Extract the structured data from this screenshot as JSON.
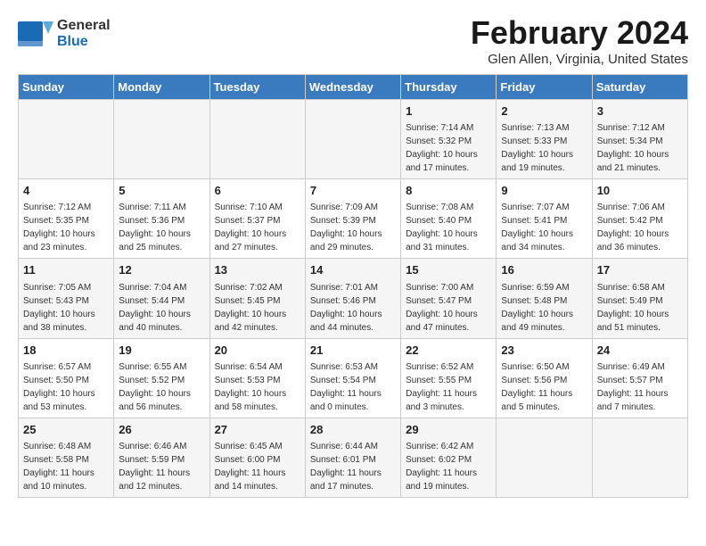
{
  "header": {
    "logo_line1": "General",
    "logo_line2": "Blue",
    "title": "February 2024",
    "subtitle": "Glen Allen, Virginia, United States"
  },
  "calendar": {
    "days_of_week": [
      "Sunday",
      "Monday",
      "Tuesday",
      "Wednesday",
      "Thursday",
      "Friday",
      "Saturday"
    ],
    "weeks": [
      [
        {
          "day": "",
          "info": ""
        },
        {
          "day": "",
          "info": ""
        },
        {
          "day": "",
          "info": ""
        },
        {
          "day": "",
          "info": ""
        },
        {
          "day": "1",
          "info": "Sunrise: 7:14 AM\nSunset: 5:32 PM\nDaylight: 10 hours\nand 17 minutes."
        },
        {
          "day": "2",
          "info": "Sunrise: 7:13 AM\nSunset: 5:33 PM\nDaylight: 10 hours\nand 19 minutes."
        },
        {
          "day": "3",
          "info": "Sunrise: 7:12 AM\nSunset: 5:34 PM\nDaylight: 10 hours\nand 21 minutes."
        }
      ],
      [
        {
          "day": "4",
          "info": "Sunrise: 7:12 AM\nSunset: 5:35 PM\nDaylight: 10 hours\nand 23 minutes."
        },
        {
          "day": "5",
          "info": "Sunrise: 7:11 AM\nSunset: 5:36 PM\nDaylight: 10 hours\nand 25 minutes."
        },
        {
          "day": "6",
          "info": "Sunrise: 7:10 AM\nSunset: 5:37 PM\nDaylight: 10 hours\nand 27 minutes."
        },
        {
          "day": "7",
          "info": "Sunrise: 7:09 AM\nSunset: 5:39 PM\nDaylight: 10 hours\nand 29 minutes."
        },
        {
          "day": "8",
          "info": "Sunrise: 7:08 AM\nSunset: 5:40 PM\nDaylight: 10 hours\nand 31 minutes."
        },
        {
          "day": "9",
          "info": "Sunrise: 7:07 AM\nSunset: 5:41 PM\nDaylight: 10 hours\nand 34 minutes."
        },
        {
          "day": "10",
          "info": "Sunrise: 7:06 AM\nSunset: 5:42 PM\nDaylight: 10 hours\nand 36 minutes."
        }
      ],
      [
        {
          "day": "11",
          "info": "Sunrise: 7:05 AM\nSunset: 5:43 PM\nDaylight: 10 hours\nand 38 minutes."
        },
        {
          "day": "12",
          "info": "Sunrise: 7:04 AM\nSunset: 5:44 PM\nDaylight: 10 hours\nand 40 minutes."
        },
        {
          "day": "13",
          "info": "Sunrise: 7:02 AM\nSunset: 5:45 PM\nDaylight: 10 hours\nand 42 minutes."
        },
        {
          "day": "14",
          "info": "Sunrise: 7:01 AM\nSunset: 5:46 PM\nDaylight: 10 hours\nand 44 minutes."
        },
        {
          "day": "15",
          "info": "Sunrise: 7:00 AM\nSunset: 5:47 PM\nDaylight: 10 hours\nand 47 minutes."
        },
        {
          "day": "16",
          "info": "Sunrise: 6:59 AM\nSunset: 5:48 PM\nDaylight: 10 hours\nand 49 minutes."
        },
        {
          "day": "17",
          "info": "Sunrise: 6:58 AM\nSunset: 5:49 PM\nDaylight: 10 hours\nand 51 minutes."
        }
      ],
      [
        {
          "day": "18",
          "info": "Sunrise: 6:57 AM\nSunset: 5:50 PM\nDaylight: 10 hours\nand 53 minutes."
        },
        {
          "day": "19",
          "info": "Sunrise: 6:55 AM\nSunset: 5:52 PM\nDaylight: 10 hours\nand 56 minutes."
        },
        {
          "day": "20",
          "info": "Sunrise: 6:54 AM\nSunset: 5:53 PM\nDaylight: 10 hours\nand 58 minutes."
        },
        {
          "day": "21",
          "info": "Sunrise: 6:53 AM\nSunset: 5:54 PM\nDaylight: 11 hours\nand 0 minutes."
        },
        {
          "day": "22",
          "info": "Sunrise: 6:52 AM\nSunset: 5:55 PM\nDaylight: 11 hours\nand 3 minutes."
        },
        {
          "day": "23",
          "info": "Sunrise: 6:50 AM\nSunset: 5:56 PM\nDaylight: 11 hours\nand 5 minutes."
        },
        {
          "day": "24",
          "info": "Sunrise: 6:49 AM\nSunset: 5:57 PM\nDaylight: 11 hours\nand 7 minutes."
        }
      ],
      [
        {
          "day": "25",
          "info": "Sunrise: 6:48 AM\nSunset: 5:58 PM\nDaylight: 11 hours\nand 10 minutes."
        },
        {
          "day": "26",
          "info": "Sunrise: 6:46 AM\nSunset: 5:59 PM\nDaylight: 11 hours\nand 12 minutes."
        },
        {
          "day": "27",
          "info": "Sunrise: 6:45 AM\nSunset: 6:00 PM\nDaylight: 11 hours\nand 14 minutes."
        },
        {
          "day": "28",
          "info": "Sunrise: 6:44 AM\nSunset: 6:01 PM\nDaylight: 11 hours\nand 17 minutes."
        },
        {
          "day": "29",
          "info": "Sunrise: 6:42 AM\nSunset: 6:02 PM\nDaylight: 11 hours\nand 19 minutes."
        },
        {
          "day": "",
          "info": ""
        },
        {
          "day": "",
          "info": ""
        }
      ]
    ]
  }
}
